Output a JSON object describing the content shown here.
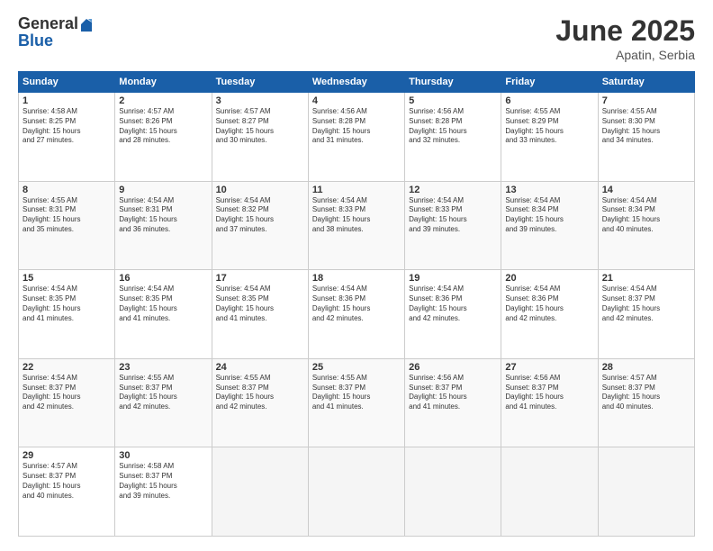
{
  "header": {
    "logo_general": "General",
    "logo_blue": "Blue",
    "month_title": "June 2025",
    "subtitle": "Apatin, Serbia"
  },
  "days_of_week": [
    "Sunday",
    "Monday",
    "Tuesday",
    "Wednesday",
    "Thursday",
    "Friday",
    "Saturday"
  ],
  "weeks": [
    [
      {
        "day": "1",
        "info": "Sunrise: 4:58 AM\nSunset: 8:25 PM\nDaylight: 15 hours\nand 27 minutes."
      },
      {
        "day": "2",
        "info": "Sunrise: 4:57 AM\nSunset: 8:26 PM\nDaylight: 15 hours\nand 28 minutes."
      },
      {
        "day": "3",
        "info": "Sunrise: 4:57 AM\nSunset: 8:27 PM\nDaylight: 15 hours\nand 30 minutes."
      },
      {
        "day": "4",
        "info": "Sunrise: 4:56 AM\nSunset: 8:28 PM\nDaylight: 15 hours\nand 31 minutes."
      },
      {
        "day": "5",
        "info": "Sunrise: 4:56 AM\nSunset: 8:28 PM\nDaylight: 15 hours\nand 32 minutes."
      },
      {
        "day": "6",
        "info": "Sunrise: 4:55 AM\nSunset: 8:29 PM\nDaylight: 15 hours\nand 33 minutes."
      },
      {
        "day": "7",
        "info": "Sunrise: 4:55 AM\nSunset: 8:30 PM\nDaylight: 15 hours\nand 34 minutes."
      }
    ],
    [
      {
        "day": "8",
        "info": "Sunrise: 4:55 AM\nSunset: 8:31 PM\nDaylight: 15 hours\nand 35 minutes."
      },
      {
        "day": "9",
        "info": "Sunrise: 4:54 AM\nSunset: 8:31 PM\nDaylight: 15 hours\nand 36 minutes."
      },
      {
        "day": "10",
        "info": "Sunrise: 4:54 AM\nSunset: 8:32 PM\nDaylight: 15 hours\nand 37 minutes."
      },
      {
        "day": "11",
        "info": "Sunrise: 4:54 AM\nSunset: 8:33 PM\nDaylight: 15 hours\nand 38 minutes."
      },
      {
        "day": "12",
        "info": "Sunrise: 4:54 AM\nSunset: 8:33 PM\nDaylight: 15 hours\nand 39 minutes."
      },
      {
        "day": "13",
        "info": "Sunrise: 4:54 AM\nSunset: 8:34 PM\nDaylight: 15 hours\nand 39 minutes."
      },
      {
        "day": "14",
        "info": "Sunrise: 4:54 AM\nSunset: 8:34 PM\nDaylight: 15 hours\nand 40 minutes."
      }
    ],
    [
      {
        "day": "15",
        "info": "Sunrise: 4:54 AM\nSunset: 8:35 PM\nDaylight: 15 hours\nand 41 minutes."
      },
      {
        "day": "16",
        "info": "Sunrise: 4:54 AM\nSunset: 8:35 PM\nDaylight: 15 hours\nand 41 minutes."
      },
      {
        "day": "17",
        "info": "Sunrise: 4:54 AM\nSunset: 8:35 PM\nDaylight: 15 hours\nand 41 minutes."
      },
      {
        "day": "18",
        "info": "Sunrise: 4:54 AM\nSunset: 8:36 PM\nDaylight: 15 hours\nand 42 minutes."
      },
      {
        "day": "19",
        "info": "Sunrise: 4:54 AM\nSunset: 8:36 PM\nDaylight: 15 hours\nand 42 minutes."
      },
      {
        "day": "20",
        "info": "Sunrise: 4:54 AM\nSunset: 8:36 PM\nDaylight: 15 hours\nand 42 minutes."
      },
      {
        "day": "21",
        "info": "Sunrise: 4:54 AM\nSunset: 8:37 PM\nDaylight: 15 hours\nand 42 minutes."
      }
    ],
    [
      {
        "day": "22",
        "info": "Sunrise: 4:54 AM\nSunset: 8:37 PM\nDaylight: 15 hours\nand 42 minutes."
      },
      {
        "day": "23",
        "info": "Sunrise: 4:55 AM\nSunset: 8:37 PM\nDaylight: 15 hours\nand 42 minutes."
      },
      {
        "day": "24",
        "info": "Sunrise: 4:55 AM\nSunset: 8:37 PM\nDaylight: 15 hours\nand 42 minutes."
      },
      {
        "day": "25",
        "info": "Sunrise: 4:55 AM\nSunset: 8:37 PM\nDaylight: 15 hours\nand 41 minutes."
      },
      {
        "day": "26",
        "info": "Sunrise: 4:56 AM\nSunset: 8:37 PM\nDaylight: 15 hours\nand 41 minutes."
      },
      {
        "day": "27",
        "info": "Sunrise: 4:56 AM\nSunset: 8:37 PM\nDaylight: 15 hours\nand 41 minutes."
      },
      {
        "day": "28",
        "info": "Sunrise: 4:57 AM\nSunset: 8:37 PM\nDaylight: 15 hours\nand 40 minutes."
      }
    ],
    [
      {
        "day": "29",
        "info": "Sunrise: 4:57 AM\nSunset: 8:37 PM\nDaylight: 15 hours\nand 40 minutes."
      },
      {
        "day": "30",
        "info": "Sunrise: 4:58 AM\nSunset: 8:37 PM\nDaylight: 15 hours\nand 39 minutes."
      },
      null,
      null,
      null,
      null,
      null
    ]
  ]
}
